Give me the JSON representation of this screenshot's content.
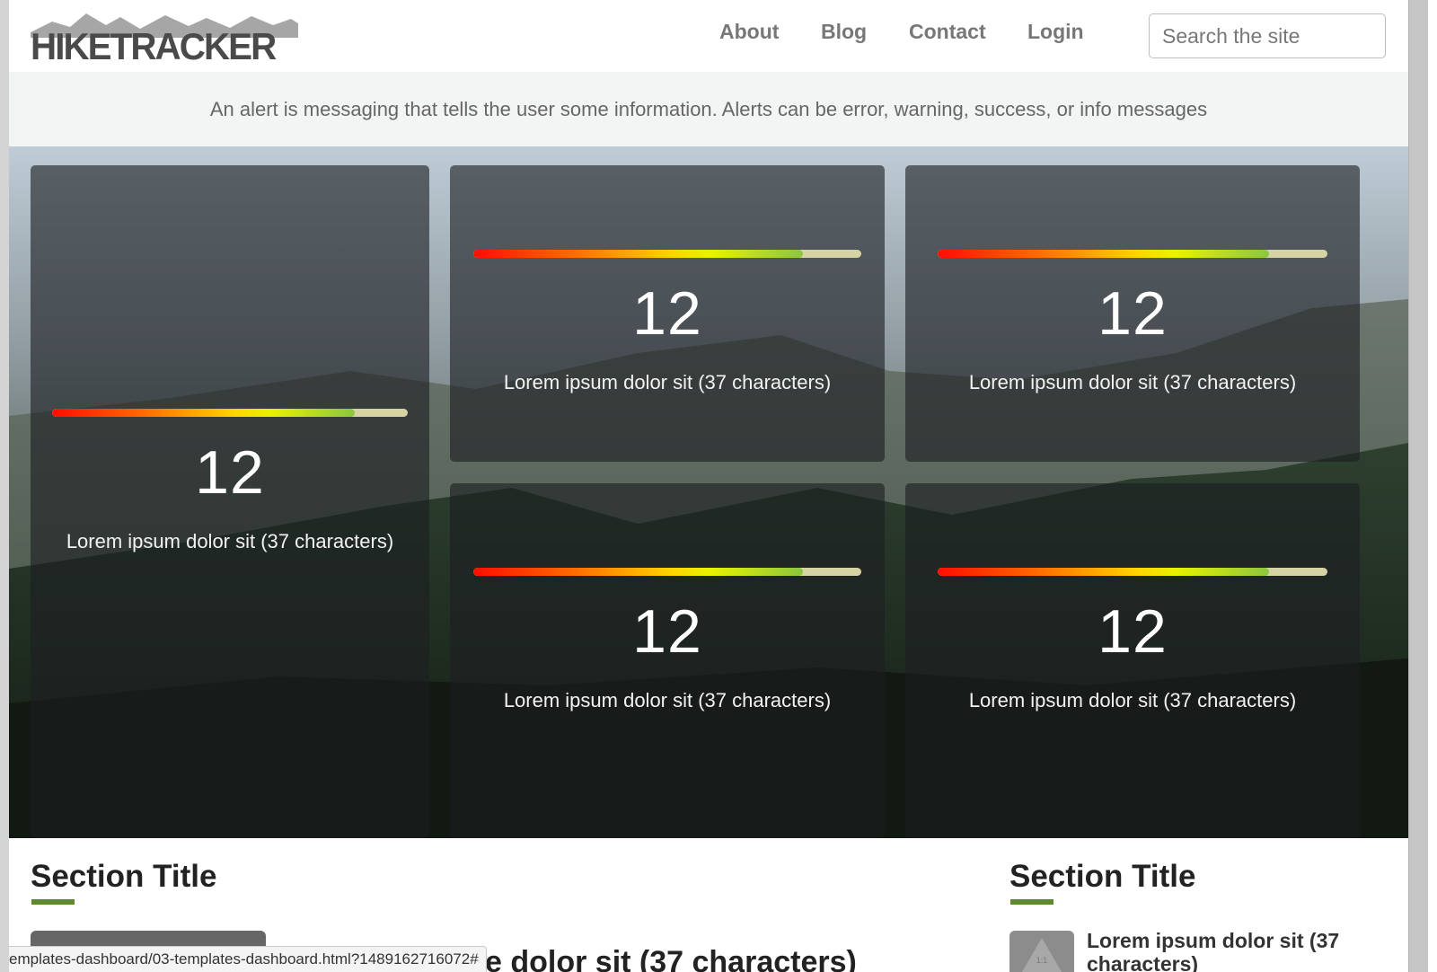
{
  "header": {
    "logo_text": "HIKETRACKER",
    "nav": [
      "About",
      "Blog",
      "Contact",
      "Login"
    ],
    "search_placeholder": "Search the site"
  },
  "alert": {
    "text": "An alert is messaging that tells the user some information. Alerts can be error, warning, success, or info messages"
  },
  "tiles": [
    {
      "value": "12",
      "label": "Lorem ipsum dolor sit (37 characters)",
      "progress": 0.85
    },
    {
      "value": "12",
      "label": "Lorem ipsum dolor sit (37 characters)",
      "progress": 0.85
    },
    {
      "value": "12",
      "label": "Lorem ipsum dolor sit (37 characters)",
      "progress": 0.85
    },
    {
      "value": "12",
      "label": "Lorem ipsum dolor sit (37 characters)",
      "progress": 0.85
    },
    {
      "value": "12",
      "label": "Lorem ipsum dolor sit (37 characters)",
      "progress": 0.85
    }
  ],
  "sections": {
    "left_title": "Section Title",
    "right_title": "Section Title",
    "right_item_text": "Lorem ipsum dolor sit (37 characters)",
    "thumb_label": "1:1",
    "partial_text": "e dolor sit (37 characters)"
  },
  "status_bar": {
    "url": "emplates-dashboard/03-templates-dashboard.html?1489162716072#"
  },
  "colors": {
    "accent_green": "#5d8a2d",
    "progress_track": "#d6d3a4",
    "logo_gray": "#4a4a4a"
  }
}
